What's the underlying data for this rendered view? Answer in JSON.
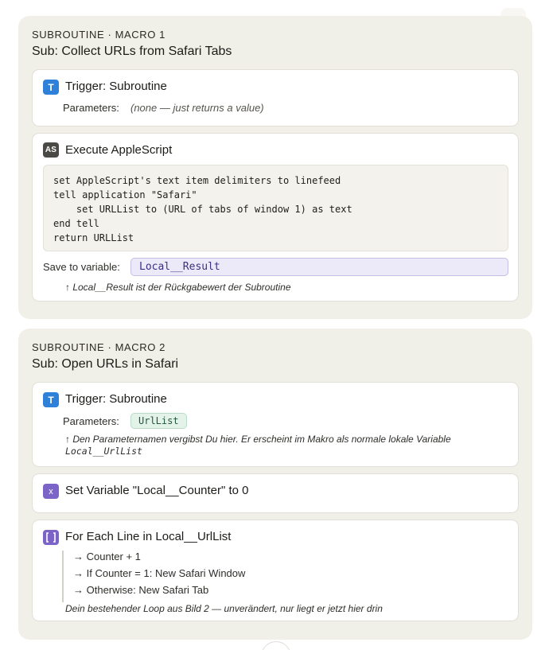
{
  "toolbar": {
    "more_label": "···"
  },
  "macro1": {
    "kicker": "SUBROUTINE · MACRO 1",
    "title": "Sub: Collect URLs from Safari Tabs",
    "trigger": {
      "badge": "T",
      "title": "Trigger: Subroutine",
      "params_label": "Parameters:",
      "params_value": "(none — just returns a value)"
    },
    "script": {
      "badge": "AS",
      "title": "Execute AppleScript",
      "code": "set AppleScript's text item delimiters to linefeed\ntell application \"Safari\"\n    set URLList to (URL of tabs of window 1) as text\nend tell\nreturn URLList",
      "save_label": "Save to variable:",
      "save_value": "Local__Result",
      "note": "↑ Local__Result ist der Rückgabewert der Subroutine"
    }
  },
  "macro2": {
    "kicker": "SUBROUTINE · MACRO 2",
    "title": "Sub: Open URLs in Safari",
    "trigger": {
      "badge": "T",
      "title": "Trigger: Subroutine",
      "params_label": "Parameters:",
      "param_chip": "UrlList",
      "note_text": "↑ Den Parameternamen vergibst Du hier. Er erscheint im Makro als normale lokale Variable",
      "note_code": "Local__UrlList"
    },
    "setvar": {
      "badge": "x",
      "title": "Set Variable \"Local__Counter\" to 0"
    },
    "loop": {
      "title": "For Each Line in Local__UrlList",
      "steps": [
        "→ Counter + 1",
        "→ If Counter = 1: New Safari Window",
        "→ Otherwise: New Safari Tab"
      ],
      "note": "Dein bestehender Loop aus Bild 2 — unverändert, nur liegt er jetzt hier drin"
    }
  },
  "colors": {
    "panel_bg": "#f1f0e8",
    "badge_blue": "#2f80d8",
    "badge_dark": "#4a4945",
    "badge_purple": "#7b63c8",
    "variable_field": "#eceaf8",
    "param_chip": "#e4f3ea"
  },
  "icons": [
    "more-horizontal-icon",
    "trigger-icon",
    "applescript-icon",
    "variable-icon",
    "loop-icon"
  ]
}
